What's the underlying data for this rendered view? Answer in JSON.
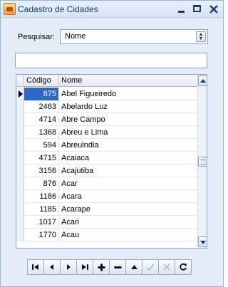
{
  "window": {
    "title": "Cadastro de Cidades",
    "controls": {
      "minimize": "minimize",
      "maximize": "maximize",
      "close": "close"
    }
  },
  "search": {
    "label": "Pesquisar:",
    "selected": "Nome",
    "text_value": ""
  },
  "grid": {
    "columns": [
      "Código",
      "Nome"
    ],
    "rows": [
      {
        "code": "875",
        "name": "Abel Figueiredo"
      },
      {
        "code": "2463",
        "name": "Abelardo Luz"
      },
      {
        "code": "4714",
        "name": "Abre Campo"
      },
      {
        "code": "1368",
        "name": "Abreu e Lima"
      },
      {
        "code": "594",
        "name": "Abreulndia"
      },
      {
        "code": "4715",
        "name": "Acaiaca"
      },
      {
        "code": "3156",
        "name": "Acajutiba"
      },
      {
        "code": "876",
        "name": "Acar"
      },
      {
        "code": "1186",
        "name": "Acara"
      },
      {
        "code": "1185",
        "name": "Acarape"
      },
      {
        "code": "1017",
        "name": "Acari"
      },
      {
        "code": "1770",
        "name": "Acau"
      }
    ]
  },
  "navigator": [
    {
      "icon": "first-record-icon",
      "enabled": true
    },
    {
      "icon": "prior-record-icon",
      "enabled": true
    },
    {
      "icon": "next-record-icon",
      "enabled": true
    },
    {
      "icon": "last-record-icon",
      "enabled": true
    },
    {
      "icon": "insert-icon",
      "enabled": true
    },
    {
      "icon": "delete-icon",
      "enabled": true
    },
    {
      "icon": "edit-icon",
      "enabled": true
    },
    {
      "icon": "post-icon",
      "enabled": false
    },
    {
      "icon": "cancel-icon",
      "enabled": false
    },
    {
      "icon": "refresh-icon",
      "enabled": true
    }
  ],
  "colors": {
    "selection": "#2f66c8",
    "window_bg": "#e4ecf7",
    "border": "#8da2c1"
  }
}
